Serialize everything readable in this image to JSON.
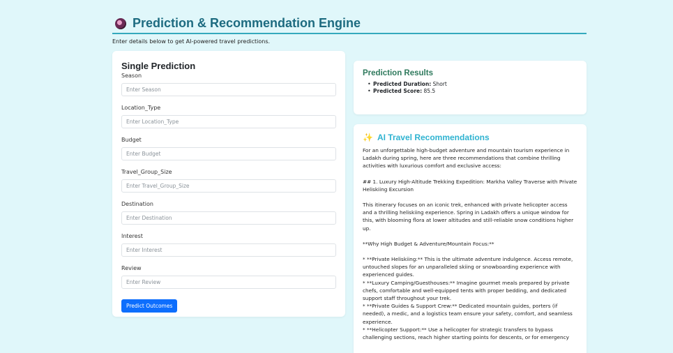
{
  "header": {
    "title": "Prediction & Recommendation Engine",
    "icon": "crystal-ball-icon",
    "subtitle": "Enter details below to get AI-powered travel predictions."
  },
  "form": {
    "title": "Single Prediction",
    "fields": [
      {
        "label": "Season",
        "placeholder": "Enter Season"
      },
      {
        "label": "Location_Type",
        "placeholder": "Enter Location_Type"
      },
      {
        "label": "Budget",
        "placeholder": "Enter Budget"
      },
      {
        "label": "Travel_Group_Size",
        "placeholder": "Enter Travel_Group_Size"
      },
      {
        "label": "Destination",
        "placeholder": "Enter Destination"
      },
      {
        "label": "Interest",
        "placeholder": "Enter Interest"
      },
      {
        "label": "Review",
        "placeholder": "Enter Review"
      }
    ],
    "submit_label": "Predict Outcomes"
  },
  "results": {
    "title": "Prediction Results",
    "items": [
      {
        "key": "Predicted Duration:",
        "value": " Short"
      },
      {
        "key": "Predicted Score:",
        "value": " 85.5"
      }
    ]
  },
  "recommendations": {
    "icon": "sparkles-icon",
    "title": "AI Travel Recommendations",
    "paragraphs": [
      "For an unforgettable high-budget adventure and mountain tourism experience in Ladakh during spring, here are three recommendations that combine thrilling activities with luxurious comfort and exclusive access:",
      "## 1. Luxury High-Altitude Trekking Expedition: Markha Valley Traverse with Private Heliskiing Excursion",
      "This itinerary focuses on an iconic trek, enhanced with private helicopter access and a thrilling heliskiing experience. Spring in Ladakh offers a unique window for this, with blooming flora at lower altitudes and still-reliable snow conditions higher up.",
      "**Why High Budget & Adventure/Mountain Focus:**"
    ],
    "bullets": [
      "*   **Private Heliskiing:** This is the ultimate adventure indulgence. Access remote, untouched slopes for an unparalleled skiing or snowboarding experience with experienced guides.",
      "*   **Luxury Camping/Guesthouses:** Imagine gourmet meals prepared by private chefs, comfortable and well-equipped tents with proper bedding, and dedicated support staff throughout your trek.",
      "*   **Private Guides & Support Crew:** Dedicated mountain guides, porters (if needed), a medic, and a logistics team ensure your safety, comfort, and seamless experience.",
      "*   **Helicopter Support:** Use a helicopter for strategic transfers to bypass challenging sections, reach higher starting points for descents, or for emergency"
    ]
  }
}
